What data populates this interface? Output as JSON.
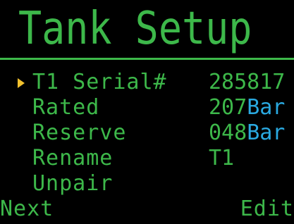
{
  "title": "Tank Setup",
  "colors": {
    "background": "#000000",
    "text_green": "#3db84a",
    "unit_blue": "#2aa9e0",
    "cursor_yellow": "#f2c12e"
  },
  "menu": {
    "items": [
      {
        "label": "T1 Serial#",
        "value": "285817",
        "unit": ""
      },
      {
        "label": "Rated",
        "value": "207",
        "unit": "Bar"
      },
      {
        "label": "Reserve",
        "value": "048",
        "unit": "Bar"
      },
      {
        "label": "Rename",
        "value": "T1",
        "unit": ""
      },
      {
        "label": "Unpair",
        "value": "",
        "unit": ""
      }
    ],
    "selected_index": 0
  },
  "softkeys": {
    "left": "Next",
    "right": "Edit"
  }
}
